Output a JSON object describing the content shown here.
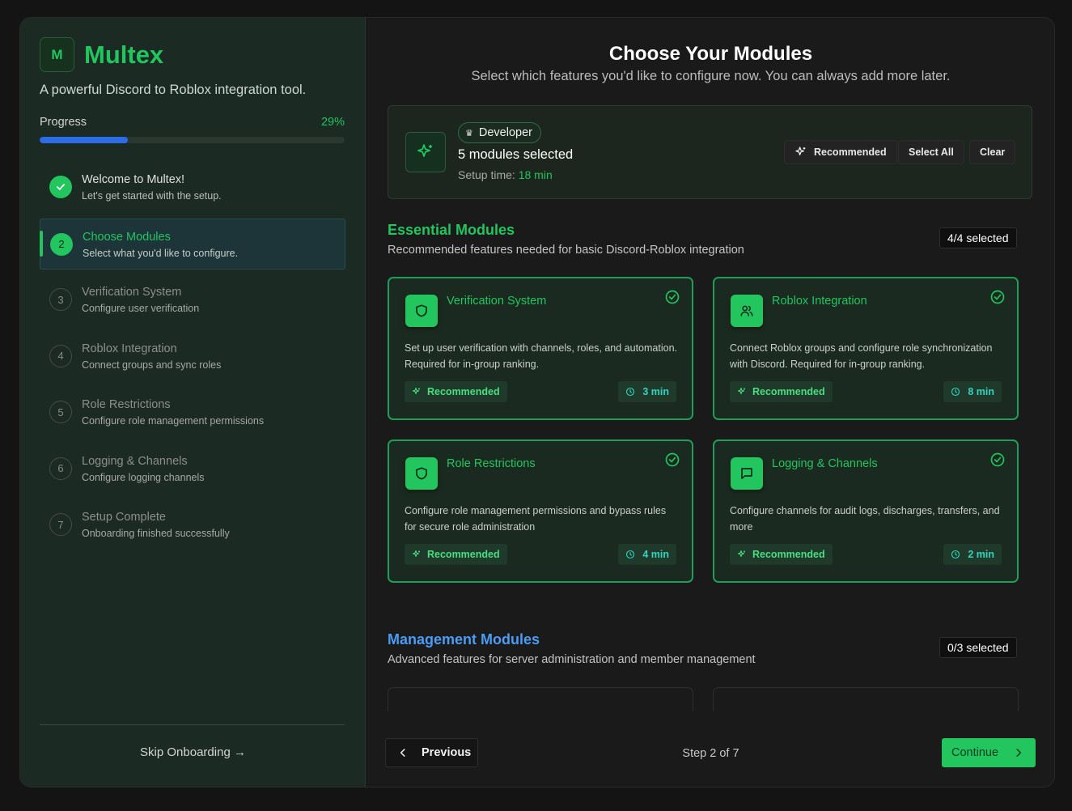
{
  "sidebar": {
    "logo_letter": "M",
    "brand": "Multex",
    "tagline": "A powerful Discord to Roblox integration tool.",
    "progress_label": "Progress",
    "progress_percent_text": "29%",
    "progress_value": 0.29,
    "steps": [
      {
        "num": "1",
        "title": "Welcome to Multex!",
        "subtitle": "Let's get started with the setup.",
        "state": "done"
      },
      {
        "num": "2",
        "title": "Choose Modules",
        "subtitle": "Select what you'd like to configure.",
        "state": "active"
      },
      {
        "num": "3",
        "title": "Verification System",
        "subtitle": "Configure user verification",
        "state": "pending"
      },
      {
        "num": "4",
        "title": "Roblox Integration",
        "subtitle": "Connect groups and sync roles",
        "state": "pending"
      },
      {
        "num": "5",
        "title": "Role Restrictions",
        "subtitle": "Configure role management permissions",
        "state": "pending"
      },
      {
        "num": "6",
        "title": "Logging & Channels",
        "subtitle": "Configure logging channels",
        "state": "pending"
      },
      {
        "num": "7",
        "title": "Setup Complete",
        "subtitle": "Onboarding finished successfully",
        "state": "pending"
      }
    ],
    "skip_label": "Skip Onboarding →"
  },
  "main": {
    "title": "Choose Your Modules",
    "subtitle": "Select which features you'd like to configure now. You can always add more later.",
    "summary": {
      "profile": "Developer",
      "modules_selected": "5 modules selected",
      "setup_time_label": "Setup time:",
      "setup_time_value": "18 min",
      "recommended_label": "Recommended",
      "select_all_label": "Select All",
      "clear_label": "Clear"
    },
    "essential": {
      "title": "Essential Modules",
      "description": "Recommended features needed for basic Discord-Roblox integration",
      "count": "4/4 selected",
      "color": "#22c55e",
      "cards": [
        {
          "title": "Verification System",
          "description": "Set up user verification with channels, roles, and automation. Required for in-group ranking.",
          "tag": "Recommended",
          "time": "3 min",
          "icon": "shield-icon"
        },
        {
          "title": "Roblox Integration",
          "description": "Connect Roblox groups and configure role synchronization with Discord. Required for in-group ranking.",
          "tag": "Recommended",
          "time": "8 min",
          "icon": "users-icon"
        },
        {
          "title": "Role Restrictions",
          "description": "Configure role management permissions and bypass rules for secure role administration",
          "tag": "Recommended",
          "time": "4 min",
          "icon": "shield-icon"
        },
        {
          "title": "Logging & Channels",
          "description": "Configure channels for audit logs, discharges, transfers, and more",
          "tag": "Recommended",
          "time": "2 min",
          "icon": "message-icon"
        }
      ]
    },
    "management": {
      "title": "Management Modules",
      "description": "Advanced features for server administration and member management",
      "count": "0/3 selected",
      "color": "#4b9cf5"
    },
    "footer": {
      "previous_label": "Previous",
      "step_indicator": "Step 2 of 7",
      "continue_label": "Continue"
    }
  }
}
